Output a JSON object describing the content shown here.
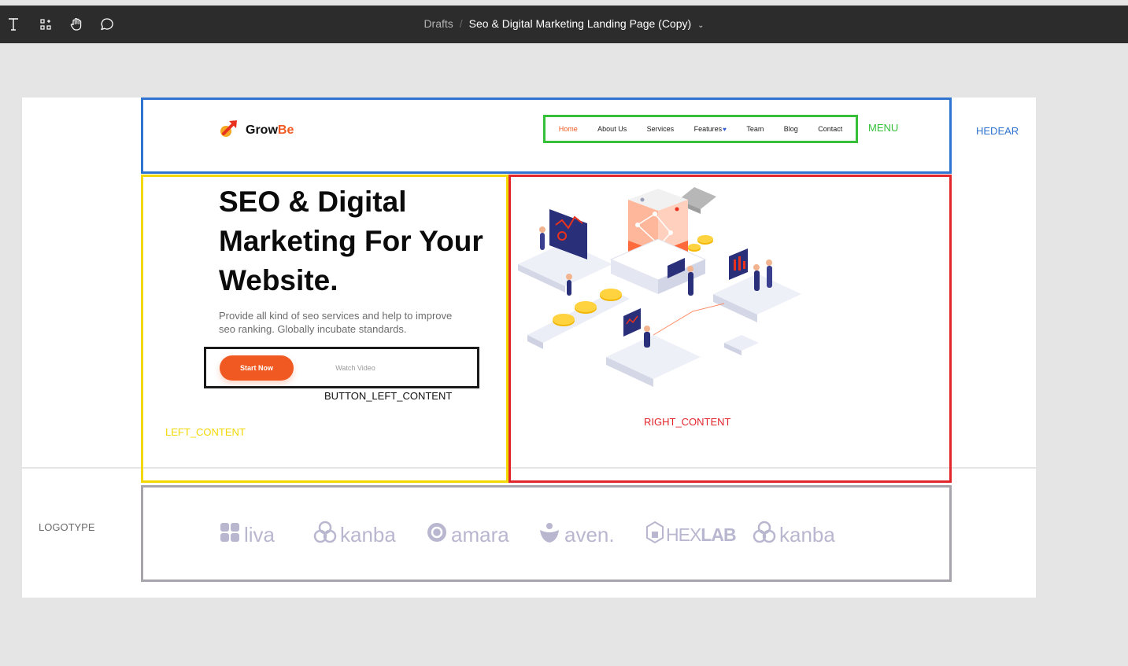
{
  "toolbar": {
    "breadcrumb_root": "Drafts",
    "breadcrumb_sep": "/",
    "file_name": "Seo & Digital Marketing Landing Page (Copy)",
    "tools": [
      "text-icon",
      "frame-icon",
      "hand-icon",
      "comment-icon"
    ]
  },
  "annotations": {
    "menu": "MENU",
    "header": "HEDEAR",
    "button_left_content": "BUTTON_LEFT_CONTENT",
    "left_content": "LEFT_CONTENT",
    "right_content": "RIGHT_CONTENT",
    "logotype": "LOGOTYPE"
  },
  "annotation_colors": {
    "header": "#2f74d0",
    "menu": "#36c03a",
    "left": "#f3d800",
    "right": "#e2242b",
    "buttons": "#1a1a1a",
    "logotype": "#a7a5ab"
  },
  "header": {
    "logo_main": "Grow",
    "logo_accent": "Be",
    "menu": [
      {
        "label": "Home",
        "active": true
      },
      {
        "label": "About Us"
      },
      {
        "label": "Services"
      },
      {
        "label": "Features"
      },
      {
        "label": "Team"
      },
      {
        "label": "Blog"
      },
      {
        "label": "Contact"
      }
    ]
  },
  "hero": {
    "headline_1": "SEO & Digital",
    "headline_2": "Marketing For Your",
    "headline_3": "Website.",
    "subtext_1": "Provide all kind of seo services and help to improve",
    "subtext_2": "seo ranking. Globally incubate standards.",
    "primary_button": "Start Now",
    "secondary_button": "Watch Video"
  },
  "brands": [
    "liva",
    "kanba",
    "amara",
    "aven.",
    "HEX",
    "LAB",
    "kanba"
  ],
  "colors": {
    "accent": "#f05a22",
    "brand_gray": "#b9b6cf",
    "illustration_navy": "#2a2f7a"
  }
}
